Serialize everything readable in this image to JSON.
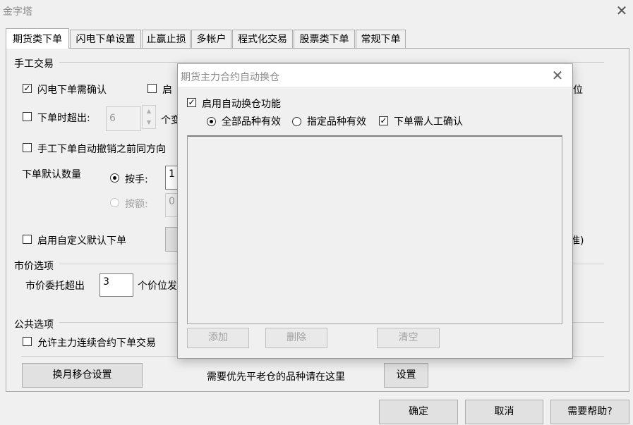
{
  "window": {
    "title": "金字塔"
  },
  "tabs": [
    {
      "label": "期货类下单",
      "active": true
    },
    {
      "label": "闪电下单设置"
    },
    {
      "label": "止赢止损"
    },
    {
      "label": "多帐户"
    },
    {
      "label": "程式化交易"
    },
    {
      "label": "股票类下单"
    },
    {
      "label": "常规下单"
    }
  ],
  "manual": {
    "section_label": "手工交易",
    "flash_confirm": "闪电下单需确认",
    "partial_enable": "启",
    "right_fragment_1": "位",
    "exceed_label": "下单时超出:",
    "exceed_value": "6",
    "exceed_unit": "个变",
    "auto_cancel": "手工下单自动撤销之前同方向",
    "default_qty_label": "下单默认数量",
    "by_lots": "按手:",
    "by_lots_value": "1",
    "by_amount": "按额:",
    "by_amount_value": "0",
    "custom_default": "启用自定义默认下单",
    "right_fragment_2": "准)"
  },
  "market": {
    "section_label": "市价选项",
    "exceed_label": "市价委托超出",
    "exceed_value": "3",
    "unit": "个价位发"
  },
  "public": {
    "section_label": "公共选项",
    "allow_continuous": "允许主力连续合约下单交易",
    "rollover_button": "换月移仓设置",
    "priority_text": "需要优先平老仓的品种请在这里",
    "setup_button": "设置"
  },
  "footer": {
    "ok": "确定",
    "cancel": "取消",
    "help": "需要帮助?"
  },
  "dialog": {
    "title": "期货主力合约自动换仓",
    "enable_auto": "启用自动换仓功能",
    "all_varieties": "全部品种有效",
    "specified_varieties": "指定品种有效",
    "manual_confirm": "下单需人工确认",
    "add": "添加",
    "delete": "删除",
    "clear": "清空"
  }
}
